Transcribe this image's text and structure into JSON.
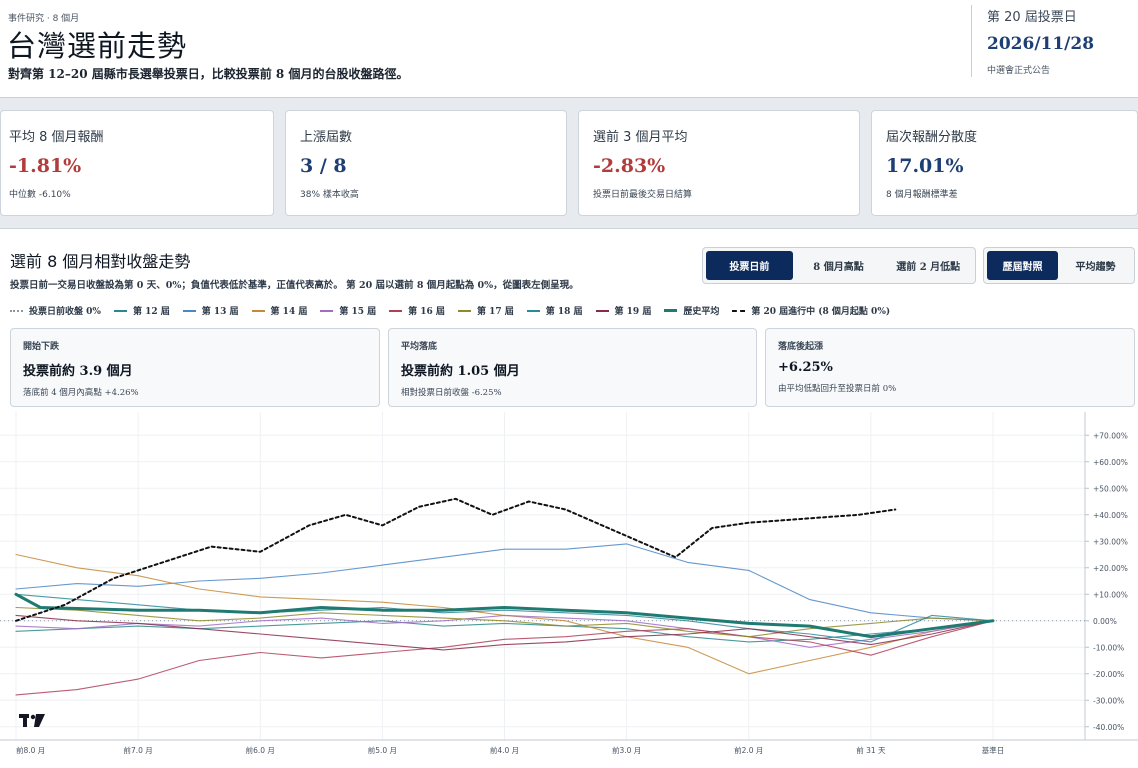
{
  "header": {
    "eyebrow": "事件研究 · 8 個月",
    "title": "台灣選前走勢",
    "subtitle": "對齊第 12–20 屆縣市長選舉投票日，比較投票前 8 個月的台股收盤路徑。",
    "election_label": "第 20 屆投票日",
    "election_date": "2026/11/28",
    "election_note": "中選會正式公告"
  },
  "kpis": [
    {
      "label": "平均 8 個月報酬",
      "value": "-1.81%",
      "note": "中位數 -6.10%",
      "tone": "neg"
    },
    {
      "label": "上漲屆數",
      "value": "3 / 8",
      "note": "38% 樣本收高",
      "tone": "pos"
    },
    {
      "label": "選前 3 個月平均",
      "value": "-2.83%",
      "note": "投票日前最後交易日結算",
      "tone": "neg"
    },
    {
      "label": "屆次報酬分散度",
      "value": "17.01%",
      "note": "8 個月報酬標準差",
      "tone": "pos"
    }
  ],
  "panel": {
    "title": "選前 8 個月相對收盤走勢",
    "description": "投票日前一交易日收盤設為第 0 天、0%；負值代表低於基準，正值代表高於。 第 20 屆以選前 8 個月起點為 0%，從圖表左側呈現。"
  },
  "anchor_buttons": [
    {
      "label": "投票日前",
      "active": true
    },
    {
      "label": "8 個月高點",
      "active": false
    },
    {
      "label": "選前 2 月低點",
      "active": false
    }
  ],
  "view_buttons": [
    {
      "label": "歷屆對照",
      "active": true
    },
    {
      "label": "平均趨勢",
      "active": false
    }
  ],
  "legend": [
    {
      "label": "投票日前收盤 0%",
      "color": "#8a96a6",
      "style": "dotted"
    },
    {
      "label": "第 12 屆",
      "color": "#2a8a8a",
      "style": "solid"
    },
    {
      "label": "第 13 屆",
      "color": "#4b86c5",
      "style": "solid"
    },
    {
      "label": "第 14 屆",
      "color": "#c48a3a",
      "style": "solid"
    },
    {
      "label": "第 15 屆",
      "color": "#a06cc4",
      "style": "solid"
    },
    {
      "label": "第 16 屆",
      "color": "#b0405a",
      "style": "solid"
    },
    {
      "label": "第 17 屆",
      "color": "#8d8a2a",
      "style": "solid"
    },
    {
      "label": "第 18 屆",
      "color": "#2a8a9a",
      "style": "solid"
    },
    {
      "label": "第 19 屆",
      "color": "#8a2a4a",
      "style": "solid"
    },
    {
      "label": "歷史平均",
      "color": "#1f7a72",
      "style": "thick"
    },
    {
      "label": "第 20 屆進行中 (8 個月起點 0%)",
      "color": "#111111",
      "style": "dashed"
    }
  ],
  "info_cards": [
    {
      "label": "開始下跌",
      "value": "投票前約 3.9 個月",
      "note": "落底前 4 個月內高點 +4.26%"
    },
    {
      "label": "平均落底",
      "value": "投票前約 1.05 個月",
      "note": "相對投票日前收盤 -6.25%"
    },
    {
      "label": "落底後起漲",
      "value": "+6.25%",
      "note": "由平均低點回升至投票日前 0%"
    }
  ],
  "chart_data": {
    "type": "line",
    "x_ticks": [
      "前8.0 月",
      "前7.0 月",
      "前6.0 月",
      "前5.0 月",
      "前4.0 月",
      "前3.0 月",
      "前2.0 月",
      "前 31 天",
      "基準日"
    ],
    "x_range_months": [
      -8.1,
      0.8
    ],
    "y_ticks": [
      "+70.00%",
      "+60.00%",
      "+50.00%",
      "+40.00%",
      "+30.00%",
      "+20.00%",
      "+10.00%",
      "0.00%",
      "-10.00%",
      "-20.00%",
      "-30.00%",
      "-40.00%"
    ],
    "ylim": [
      -45,
      75
    ],
    "series": [
      {
        "name": "第 12 屆",
        "color": "#2a8a8a",
        "points": [
          [
            -8,
            -4
          ],
          [
            -7.5,
            -3
          ],
          [
            -7,
            -2
          ],
          [
            -6.5,
            -3
          ],
          [
            -6,
            -2
          ],
          [
            -5.5,
            -1
          ],
          [
            -5,
            0
          ],
          [
            -4.5,
            -2
          ],
          [
            -4,
            -1
          ],
          [
            -3.5,
            -2
          ],
          [
            -3,
            -3
          ],
          [
            -2.5,
            -6
          ],
          [
            -2,
            -8
          ],
          [
            -1.5,
            -7
          ],
          [
            -1,
            -5
          ],
          [
            -0.5,
            -3
          ],
          [
            0,
            0
          ]
        ]
      },
      {
        "name": "第 13 屆",
        "color": "#4b86c5",
        "points": [
          [
            -8,
            12
          ],
          [
            -7.5,
            14
          ],
          [
            -7,
            13
          ],
          [
            -6.5,
            15
          ],
          [
            -6,
            16
          ],
          [
            -5.5,
            18
          ],
          [
            -5,
            21
          ],
          [
            -4.5,
            24
          ],
          [
            -4,
            27
          ],
          [
            -3.5,
            27
          ],
          [
            -3,
            29
          ],
          [
            -2.5,
            22
          ],
          [
            -2,
            19
          ],
          [
            -1.5,
            8
          ],
          [
            -1,
            3
          ],
          [
            -0.5,
            1
          ],
          [
            0,
            0
          ]
        ]
      },
      {
        "name": "第 14 屆",
        "color": "#c48a3a",
        "points": [
          [
            -8,
            25
          ],
          [
            -7.5,
            20
          ],
          [
            -7,
            17
          ],
          [
            -6.5,
            12
          ],
          [
            -6,
            9
          ],
          [
            -5.5,
            8
          ],
          [
            -5,
            7
          ],
          [
            -4.5,
            5
          ],
          [
            -4,
            2
          ],
          [
            -3.5,
            0
          ],
          [
            -3,
            -6
          ],
          [
            -2.5,
            -10
          ],
          [
            -2,
            -20
          ],
          [
            -1.5,
            -15
          ],
          [
            -1,
            -10
          ],
          [
            -0.5,
            -4
          ],
          [
            0,
            0
          ]
        ]
      },
      {
        "name": "第 15 屆",
        "color": "#a06cc4",
        "points": [
          [
            -8,
            -2
          ],
          [
            -7.5,
            -3
          ],
          [
            -7,
            -1
          ],
          [
            -6.5,
            -2
          ],
          [
            -6,
            0
          ],
          [
            -5.5,
            1
          ],
          [
            -5,
            -1
          ],
          [
            -4.5,
            0
          ],
          [
            -4,
            2
          ],
          [
            -3.5,
            1
          ],
          [
            -3,
            0
          ],
          [
            -2.5,
            -3
          ],
          [
            -2,
            -6
          ],
          [
            -1.5,
            -10
          ],
          [
            -1,
            -7
          ],
          [
            -0.5,
            -4
          ],
          [
            0,
            0
          ]
        ]
      },
      {
        "name": "第 16 屆",
        "color": "#b0405a",
        "points": [
          [
            -8,
            -28
          ],
          [
            -7.5,
            -26
          ],
          [
            -7,
            -22
          ],
          [
            -6.5,
            -15
          ],
          [
            -6,
            -12
          ],
          [
            -5.5,
            -14
          ],
          [
            -5,
            -12
          ],
          [
            -4.5,
            -10
          ],
          [
            -4,
            -7
          ],
          [
            -3.5,
            -6
          ],
          [
            -3,
            -4
          ],
          [
            -2.5,
            -3
          ],
          [
            -2,
            -6
          ],
          [
            -1.5,
            -8
          ],
          [
            -1,
            -13
          ],
          [
            -0.5,
            -6
          ],
          [
            0,
            0
          ]
        ]
      },
      {
        "name": "第 17 屆",
        "color": "#8d8a2a",
        "points": [
          [
            -8,
            5
          ],
          [
            -7.5,
            4
          ],
          [
            -7,
            2
          ],
          [
            -6.5,
            0
          ],
          [
            -6,
            1
          ],
          [
            -5.5,
            3
          ],
          [
            -5,
            2
          ],
          [
            -4.5,
            1
          ],
          [
            -4,
            0
          ],
          [
            -3.5,
            -2
          ],
          [
            -3,
            -1
          ],
          [
            -2.5,
            -4
          ],
          [
            -2,
            -6
          ],
          [
            -1.5,
            -3
          ],
          [
            -1,
            -1
          ],
          [
            -0.5,
            1
          ],
          [
            0,
            0
          ]
        ]
      },
      {
        "name": "第 18 屆",
        "color": "#2a8a9a",
        "points": [
          [
            -8,
            10
          ],
          [
            -7.5,
            8
          ],
          [
            -7,
            6
          ],
          [
            -6.5,
            4
          ],
          [
            -6,
            3
          ],
          [
            -5.5,
            4
          ],
          [
            -5,
            5
          ],
          [
            -4.5,
            3
          ],
          [
            -4,
            4
          ],
          [
            -3.5,
            3
          ],
          [
            -3,
            2
          ],
          [
            -2.5,
            0
          ],
          [
            -2,
            -3
          ],
          [
            -1.5,
            -5
          ],
          [
            -1,
            -8
          ],
          [
            -0.5,
            2
          ],
          [
            0,
            0
          ]
        ]
      },
      {
        "name": "第 19 屆",
        "color": "#8a2a4a",
        "points": [
          [
            -8,
            2
          ],
          [
            -7.5,
            0
          ],
          [
            -7,
            -1
          ],
          [
            -6.5,
            -3
          ],
          [
            -6,
            -5
          ],
          [
            -5.5,
            -7
          ],
          [
            -5,
            -9
          ],
          [
            -4.5,
            -11
          ],
          [
            -4,
            -9
          ],
          [
            -3.5,
            -8
          ],
          [
            -3,
            -6
          ],
          [
            -2.5,
            -5
          ],
          [
            -2,
            -3
          ],
          [
            -1.5,
            -6
          ],
          [
            -1,
            -9
          ],
          [
            -0.5,
            -5
          ],
          [
            0,
            0
          ]
        ]
      },
      {
        "name": "歷史平均",
        "color": "#1f7a72",
        "width": 3,
        "points": [
          [
            -8,
            10
          ],
          [
            -7.8,
            5
          ],
          [
            -7,
            4
          ],
          [
            -6.5,
            4
          ],
          [
            -6,
            3
          ],
          [
            -5.5,
            5
          ],
          [
            -5,
            4
          ],
          [
            -4.5,
            4
          ],
          [
            -4,
            5
          ],
          [
            -3.5,
            4
          ],
          [
            -3,
            3
          ],
          [
            -2.5,
            1
          ],
          [
            -2,
            -1
          ],
          [
            -1.5,
            -2
          ],
          [
            -1,
            -6
          ],
          [
            -0.5,
            -3
          ],
          [
            0,
            0
          ]
        ]
      },
      {
        "name": "第 20 屆進行中 (8 個月起點 0%)",
        "color": "#111111",
        "dash": "3,3",
        "width": 2,
        "points": [
          [
            -8,
            0
          ],
          [
            -7.6,
            6
          ],
          [
            -7.2,
            16
          ],
          [
            -6.8,
            22
          ],
          [
            -6.4,
            28
          ],
          [
            -6,
            26
          ],
          [
            -5.6,
            36
          ],
          [
            -5.3,
            40
          ],
          [
            -5,
            36
          ],
          [
            -4.7,
            43
          ],
          [
            -4.4,
            46
          ],
          [
            -4.1,
            40
          ],
          [
            -3.8,
            45
          ],
          [
            -3.5,
            42
          ],
          [
            -3.2,
            36
          ],
          [
            -2.9,
            30
          ],
          [
            -2.6,
            24
          ],
          [
            -2.3,
            35
          ],
          [
            -2,
            37
          ],
          [
            -1.7,
            38
          ],
          [
            -1.4,
            39
          ],
          [
            -1.1,
            40
          ],
          [
            -0.8,
            42
          ]
        ]
      }
    ]
  }
}
